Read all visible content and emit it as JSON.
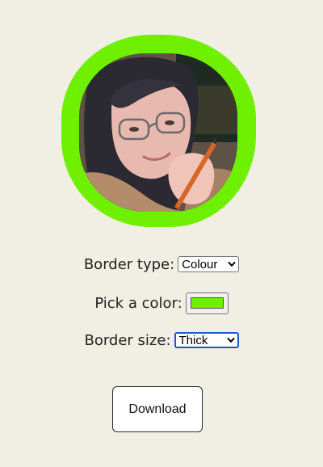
{
  "avatar": {
    "border_color": "#6ff000",
    "border_shape": "squircle"
  },
  "controls": {
    "border_type": {
      "label": "Border type:",
      "selected": "Colour"
    },
    "color": {
      "label": "Pick a color:",
      "value": "#6ff000"
    },
    "border_size": {
      "label": "Border size:",
      "selected": "Thick"
    }
  },
  "actions": {
    "download_label": "Download"
  },
  "colors": {
    "background": "#f1eee3",
    "focus_ring": "#1a56d6"
  }
}
